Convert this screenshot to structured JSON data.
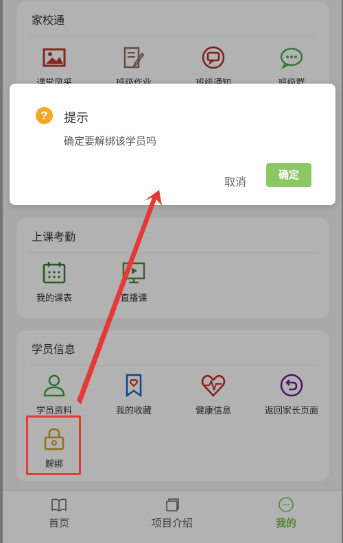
{
  "sections": {
    "home_school": {
      "title": "家校通",
      "items": [
        {
          "label": "课堂风采",
          "icon": "image-icon"
        },
        {
          "label": "班级作业",
          "icon": "homework-edit-icon"
        },
        {
          "label": "班级通知",
          "icon": "notice-chat-icon"
        },
        {
          "label": "班级群",
          "icon": "group-chat-icon"
        }
      ]
    },
    "attendance": {
      "title": "上课考勤",
      "items": [
        {
          "label": "我的课表",
          "icon": "calendar-icon"
        },
        {
          "label": "直播课",
          "icon": "monitor-icon"
        }
      ]
    },
    "student": {
      "title": "学员信息",
      "items": [
        {
          "label": "学员资料",
          "icon": "user-icon"
        },
        {
          "label": "我的收藏",
          "icon": "bookmark-heart-icon"
        },
        {
          "label": "健康信息",
          "icon": "heartbeat-icon"
        },
        {
          "label": "返回家长页面",
          "icon": "return-icon"
        },
        {
          "label": "解绑",
          "icon": "lock-icon"
        }
      ]
    }
  },
  "tabbar": {
    "tabs": [
      {
        "label": "首页",
        "icon": "book-icon"
      },
      {
        "label": "项目介绍",
        "icon": "cards-icon"
      },
      {
        "label": "我的",
        "icon": "smile-icon",
        "active": true
      }
    ]
  },
  "dialog": {
    "icon_text": "?",
    "title": "提示",
    "message": "确定要解绑该学员吗",
    "cancel_label": "取消",
    "confirm_label": "确定"
  },
  "colors": {
    "accent_green": "#8bc765",
    "warning_orange": "#f5a623",
    "highlight_red": "#e53935"
  }
}
